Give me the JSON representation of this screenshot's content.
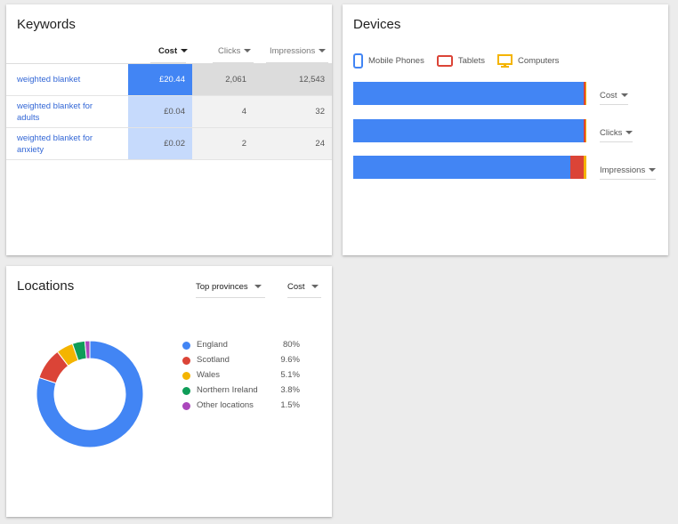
{
  "colors": {
    "blue": "#4285f4",
    "red": "#db4437",
    "yellow": "#f4b400",
    "green": "#0f9d58",
    "purple": "#ab47bc",
    "link": "#3367d6"
  },
  "keywords": {
    "title": "Keywords",
    "columns": {
      "cost": "Cost",
      "clicks": "Clicks",
      "impressions": "Impressions"
    },
    "sorted_by": "cost",
    "rows": [
      {
        "name": "weighted blanket",
        "cost": "£20.44",
        "clicks": "2,061",
        "impressions": "12,543"
      },
      {
        "name": "weighted blanket for adults",
        "cost": "£0.04",
        "clicks": "4",
        "impressions": "32"
      },
      {
        "name": "weighted blanket for anxiety",
        "cost": "£0.02",
        "clicks": "2",
        "impressions": "24"
      }
    ]
  },
  "devices": {
    "title": "Devices",
    "legend": [
      {
        "label": "Mobile Phones",
        "icon": "mobile-phone-icon",
        "color": "#4285f4"
      },
      {
        "label": "Tablets",
        "icon": "tablet-icon",
        "color": "#db4437"
      },
      {
        "label": "Computers",
        "icon": "computer-icon",
        "color": "#f4b400"
      }
    ],
    "bars": [
      {
        "metric": "Cost",
        "shares": [
          0.99,
          0.008,
          0.002
        ]
      },
      {
        "metric": "Clicks",
        "shares": [
          0.99,
          0.008,
          0.002
        ]
      },
      {
        "metric": "Impressions",
        "shares": [
          0.93,
          0.06,
          0.01
        ]
      }
    ]
  },
  "locations": {
    "title": "Locations",
    "region_dropdown": "Top provinces",
    "metric_dropdown": "Cost",
    "items": [
      {
        "name": "England",
        "pct": "80%",
        "value": 80,
        "color": "#4285f4"
      },
      {
        "name": "Scotland",
        "pct": "9.6%",
        "value": 9.6,
        "color": "#db4437"
      },
      {
        "name": "Wales",
        "pct": "5.1%",
        "value": 5.1,
        "color": "#f4b400"
      },
      {
        "name": "Northern Ireland",
        "pct": "3.8%",
        "value": 3.8,
        "color": "#0f9d58"
      },
      {
        "name": "Other locations",
        "pct": "1.5%",
        "value": 1.5,
        "color": "#ab47bc"
      }
    ]
  }
}
